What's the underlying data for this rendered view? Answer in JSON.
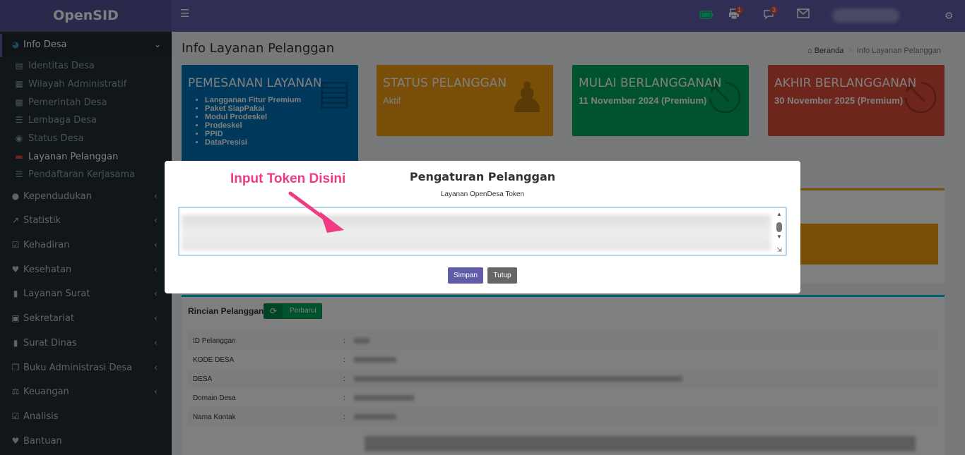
{
  "app": {
    "logo": "OpenSID"
  },
  "topbar": {
    "badge_print": "1",
    "badge_chat": "3"
  },
  "sidebar": {
    "items": [
      {
        "label": "Info Desa",
        "icon": "dashboard-icon"
      },
      {
        "label": "Identitas Desa",
        "icon": "id-card-icon"
      },
      {
        "label": "Wilayah Administratif",
        "icon": "map-icon"
      },
      {
        "label": "Pemerintah Desa",
        "icon": "sitemap-icon"
      },
      {
        "label": "Lembaga Desa",
        "icon": "list-icon"
      },
      {
        "label": "Status Desa",
        "icon": "dot-circle-icon"
      },
      {
        "label": "Layanan Pelanggan",
        "icon": "credit-card-icon"
      },
      {
        "label": "Pendaftaran Kerjasama",
        "icon": "list-icon"
      },
      {
        "label": "Kependudukan",
        "icon": "users-icon"
      },
      {
        "label": "Statistik",
        "icon": "chart-icon"
      },
      {
        "label": "Kehadiran",
        "icon": "calendar-icon"
      },
      {
        "label": "Kesehatan",
        "icon": "heartbeat-icon"
      },
      {
        "label": "Layanan Surat",
        "icon": "book-icon"
      },
      {
        "label": "Sekretariat",
        "icon": "archive-icon"
      },
      {
        "label": "Surat Dinas",
        "icon": "book-icon"
      },
      {
        "label": "Buku Administrasi Desa",
        "icon": "copy-icon"
      },
      {
        "label": "Keuangan",
        "icon": "balance-icon"
      },
      {
        "label": "Analisis",
        "icon": "check-square-icon"
      },
      {
        "label": "Bantuan",
        "icon": "heart-icon"
      }
    ]
  },
  "header": {
    "title": "Info Layanan Pelanggan",
    "crumb_home": "Beranda",
    "crumb_current": "Info Layanan Pelanggan"
  },
  "boxes": [
    {
      "title": "PEMESANAN LAYANAN",
      "list": [
        "Langganan Fitur Premium",
        "Paket SiapPakai",
        "Modul Prodeskel",
        "Prodeskel",
        "PPID",
        "DataPresisi"
      ]
    },
    {
      "title": "STATUS PELANGGAN",
      "sub": "Aktif"
    },
    {
      "title": "MULAI BERLANGGANAN",
      "sub": "11 November 2024 (Premium)"
    },
    {
      "title": "AKHIR BERLANGGANAN",
      "sub": "30 November 2025 (Premium)"
    }
  ],
  "rincian": {
    "title": "Rincian Pelanggan",
    "refresh": "Perbarui",
    "rows": [
      {
        "key": "ID Pelanggan",
        "sep": ":"
      },
      {
        "key": "KODE DESA",
        "sep": ":"
      },
      {
        "key": "DESA",
        "sep": ":"
      },
      {
        "key": "Domain Desa",
        "sep": ":"
      },
      {
        "key": "Nama Kontak",
        "sep": ":"
      }
    ]
  },
  "modal": {
    "title": "Pengaturan Pelanggan",
    "subtitle": "Layanan OpenDesa Token",
    "save": "Simpan",
    "close": "Tutup"
  },
  "annotation": {
    "text": "Input Token Disini"
  }
}
